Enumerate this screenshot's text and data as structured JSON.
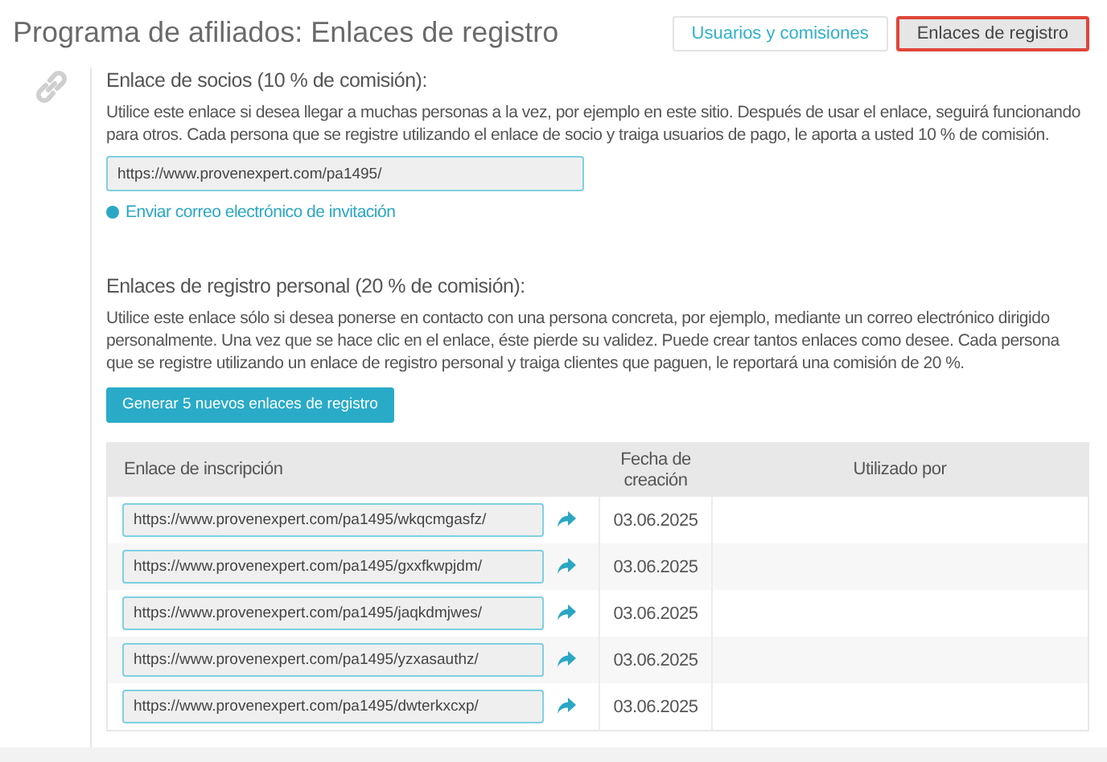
{
  "page_title": "Programa de afiliados: Enlaces de registro",
  "tabs": [
    {
      "label": "Usuarios y comisiones",
      "selected": false
    },
    {
      "label": "Enlaces de registro",
      "selected": true
    }
  ],
  "partner_link": {
    "heading": "Enlace de socios (10 % de comisión):",
    "description": "Utilice este enlace si desea llegar a muchas personas a la vez, por ejemplo en este sitio. Después de usar el enlace, seguirá funcionando para otros. Cada persona que se registre utilizando el enlace de socio y traiga usuarios de pago, le aporta a usted 10 % de comisión.",
    "url": "https://www.provenexpert.com/pa1495/",
    "invite_link": "Enviar correo electrónico de invitación"
  },
  "personal_links": {
    "heading": "Enlaces de registro personal (20 % de comisión):",
    "description": "Utilice este enlace sólo si desea ponerse en contacto con una persona concreta, por ejemplo, mediante un correo electrónico dirigido personalmente. Una vez que se hace clic en el enlace, éste pierde su validez. Puede crear tantos enlaces como desee. Cada persona que se registre utilizando un enlace de registro personal y traiga clientes que paguen, le reportará una comisión de 20 %.",
    "generate_button": "Generar 5 nuevos enlaces de registro",
    "table": {
      "columns": [
        "Enlace de inscripción",
        "Fecha de creación",
        "Utilizado por"
      ],
      "rows": [
        {
          "url": "https://www.provenexpert.com/pa1495/wkqcmgasfz/",
          "date": "03.06.2025"
        },
        {
          "url": "https://www.provenexpert.com/pa1495/gxxfkwpjdm/",
          "date": "03.06.2025"
        },
        {
          "url": "https://www.provenexpert.com/pa1495/jaqkdmjwes/",
          "date": "03.06.2025"
        },
        {
          "url": "https://www.provenexpert.com/pa1495/yzxasauthz/",
          "date": "03.06.2025"
        },
        {
          "url": "https://www.provenexpert.com/pa1495/dwterkxcxp/",
          "date": "03.06.2025"
        }
      ]
    }
  }
}
